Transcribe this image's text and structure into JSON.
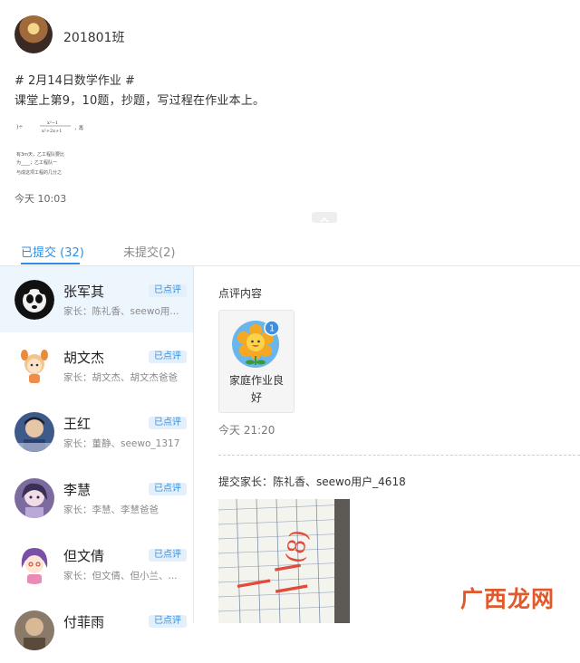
{
  "class": {
    "name": "201801班"
  },
  "homework": {
    "tag": "# 2月14日数学作业 #",
    "body": "课堂上第9，10题，抄题，写过程在作业本上。",
    "thumbnail_lines": [
      "有3m天，乙工程队要比",
      "为____；乙工程队一",
      "与成这项工程的几分之"
    ],
    "time": "今天 10:03"
  },
  "tabs": {
    "submitted": "已提交 (32)",
    "unsubmitted": "未提交(2)"
  },
  "students": [
    {
      "name": "张军其",
      "badge": "已点评",
      "parents": "家长：陈礼香、seewo用...",
      "selected": true,
      "avatar": "panda-avatar-icon"
    },
    {
      "name": "胡文杰",
      "badge": "已点评",
      "parents": "家长：胡文杰、胡文杰爸爸",
      "avatar": "deer-girl-avatar-icon"
    },
    {
      "name": "王红",
      "badge": "已点评",
      "parents": "家长：董静、seewo_1317",
      "avatar": "boy-photo-avatar-icon"
    },
    {
      "name": "李慧",
      "badge": "已点评",
      "parents": "家长：李慧、李慧爸爸",
      "avatar": "anime-avatar-icon"
    },
    {
      "name": "但文倩",
      "badge": "已点评",
      "parents": "家长：但文倩、但小兰、...",
      "avatar": "purple-girl-avatar-icon"
    },
    {
      "name": "付菲雨",
      "badge": "已点评",
      "parents": "",
      "avatar": "photo-avatar-icon"
    }
  ],
  "review": {
    "label": "点评内容",
    "medal_text": "家庭作业良好",
    "medal_count": "1",
    "time": "今天 21:20",
    "submit_parents": "提交家长：陈礼香、seewo用户_4618"
  },
  "photo_text": {
    "left": "一二",
    "right": "(8)"
  },
  "watermark": "广西龙网",
  "colors": {
    "accent": "#2f8fe0",
    "badge_bg": "#e3f0fb",
    "selected_bg": "#eef6fd",
    "watermark": "#e2572b"
  }
}
